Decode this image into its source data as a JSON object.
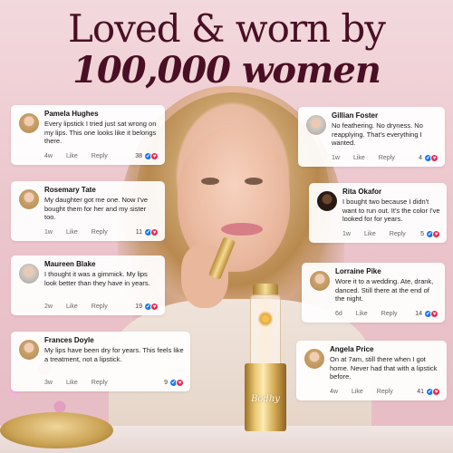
{
  "headline": {
    "line1": "Loved & worn by",
    "line2": "100,000 women"
  },
  "product": {
    "brand": "Bodhy"
  },
  "colors": {
    "headline": "#4a0f24",
    "like": "#1877f2",
    "heart": "#f0284a"
  },
  "actions": {
    "like": "Like",
    "reply": "Reply"
  },
  "icons": {
    "like": "thumbs-up-icon",
    "heart": "heart-icon"
  },
  "reviews": [
    {
      "name": "Pamela Hughes",
      "text": "Every lipstick I tried just sat wrong on my lips. This one looks like it belongs there.",
      "time": "4w",
      "count": "38"
    },
    {
      "name": "Rosemary Tate",
      "text": "My daughter got me one. Now I've bought them for her and my sister too.",
      "time": "1w",
      "count": "11"
    },
    {
      "name": "Maureen Blake",
      "text": "I thought it was a gimmick. My lips look better than they have in years.",
      "time": "2w",
      "count": "19"
    },
    {
      "name": "Frances Doyle",
      "text": "My lips have been dry for years. This feels like a treatment, not a lipstick.",
      "time": "3w",
      "count": "9"
    },
    {
      "name": "Gillian Foster",
      "text": "No feathering. No dryness. No reapplying. That's everything I wanted.",
      "time": "1w",
      "count": "4"
    },
    {
      "name": "Rita Okafor",
      "text": "I bought two because I didn't want to run out. It's the color I've looked for for years.",
      "time": "1w",
      "count": "5"
    },
    {
      "name": "Lorraine Pike",
      "text": "Wore it to a wedding. Ate, drank, danced. Still there at the end of the night.",
      "time": "6d",
      "count": "14"
    },
    {
      "name": "Angela Price",
      "text": "On at 7am, still there when I got home. Never had that with a lipstick before.",
      "time": "4w",
      "count": "41"
    }
  ]
}
